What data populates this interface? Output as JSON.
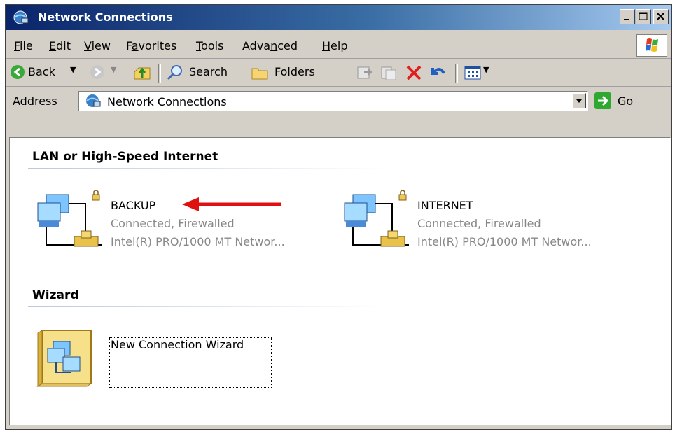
{
  "window": {
    "title": "Network Connections",
    "icon": "network-connections-icon",
    "controls": [
      "minimize",
      "maximize",
      "close"
    ]
  },
  "menubar": {
    "items": [
      {
        "label": "File",
        "access_key": "F"
      },
      {
        "label": "Edit",
        "access_key": "E"
      },
      {
        "label": "View",
        "access_key": "V"
      },
      {
        "label": "Favorites",
        "access_key": "a"
      },
      {
        "label": "Tools",
        "access_key": "T"
      },
      {
        "label": "Advanced",
        "access_key": "n"
      },
      {
        "label": "Help",
        "access_key": "H"
      }
    ]
  },
  "toolbar": {
    "back_label": "Back",
    "search_label": "Search",
    "folders_label": "Folders"
  },
  "address": {
    "label": "Address",
    "value": "Network Connections",
    "go_label": "Go"
  },
  "groups": {
    "lan": {
      "heading": "LAN or High-Speed Internet",
      "items": [
        {
          "name": "BACKUP",
          "status": "Connected, Firewalled",
          "device": "Intel(R) PRO/1000 MT Networ..."
        },
        {
          "name": "INTERNET",
          "status": "Connected, Firewalled",
          "device": "Intel(R) PRO/1000 MT Networ..."
        }
      ]
    },
    "wizard": {
      "heading": "Wizard",
      "items": [
        {
          "name": "New Connection Wizard"
        }
      ]
    }
  },
  "annotation": {
    "color": "#e01010"
  },
  "colors": {
    "titlebar_start": "#0a246a",
    "titlebar_end": "#a6caf0",
    "face": "#d4d0c8"
  }
}
